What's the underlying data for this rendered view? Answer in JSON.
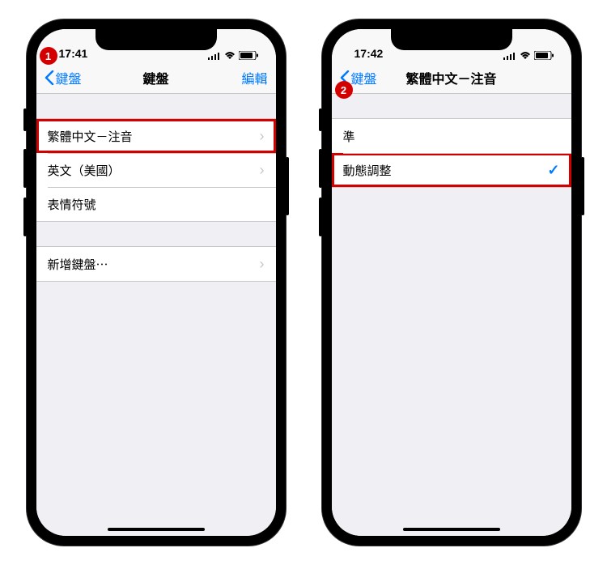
{
  "left": {
    "status": {
      "time": "17:41"
    },
    "nav": {
      "back": "鍵盤",
      "title": "鍵盤",
      "edit": "編輯"
    },
    "group1": [
      {
        "label": "繁體中文－注音",
        "highlighted": true,
        "badge": "1"
      },
      {
        "label": "英文（美國）"
      },
      {
        "label": "表情符號"
      }
    ],
    "group2": [
      {
        "label": "新增鍵盤⋯"
      }
    ]
  },
  "right": {
    "status": {
      "time": "17:42"
    },
    "nav": {
      "back": "鍵盤",
      "title": "繁體中文－注音",
      "edit": ""
    },
    "group1": [
      {
        "label": "準"
      },
      {
        "label": "動態調整",
        "highlighted": true,
        "badge": "2",
        "checked": true
      }
    ]
  }
}
